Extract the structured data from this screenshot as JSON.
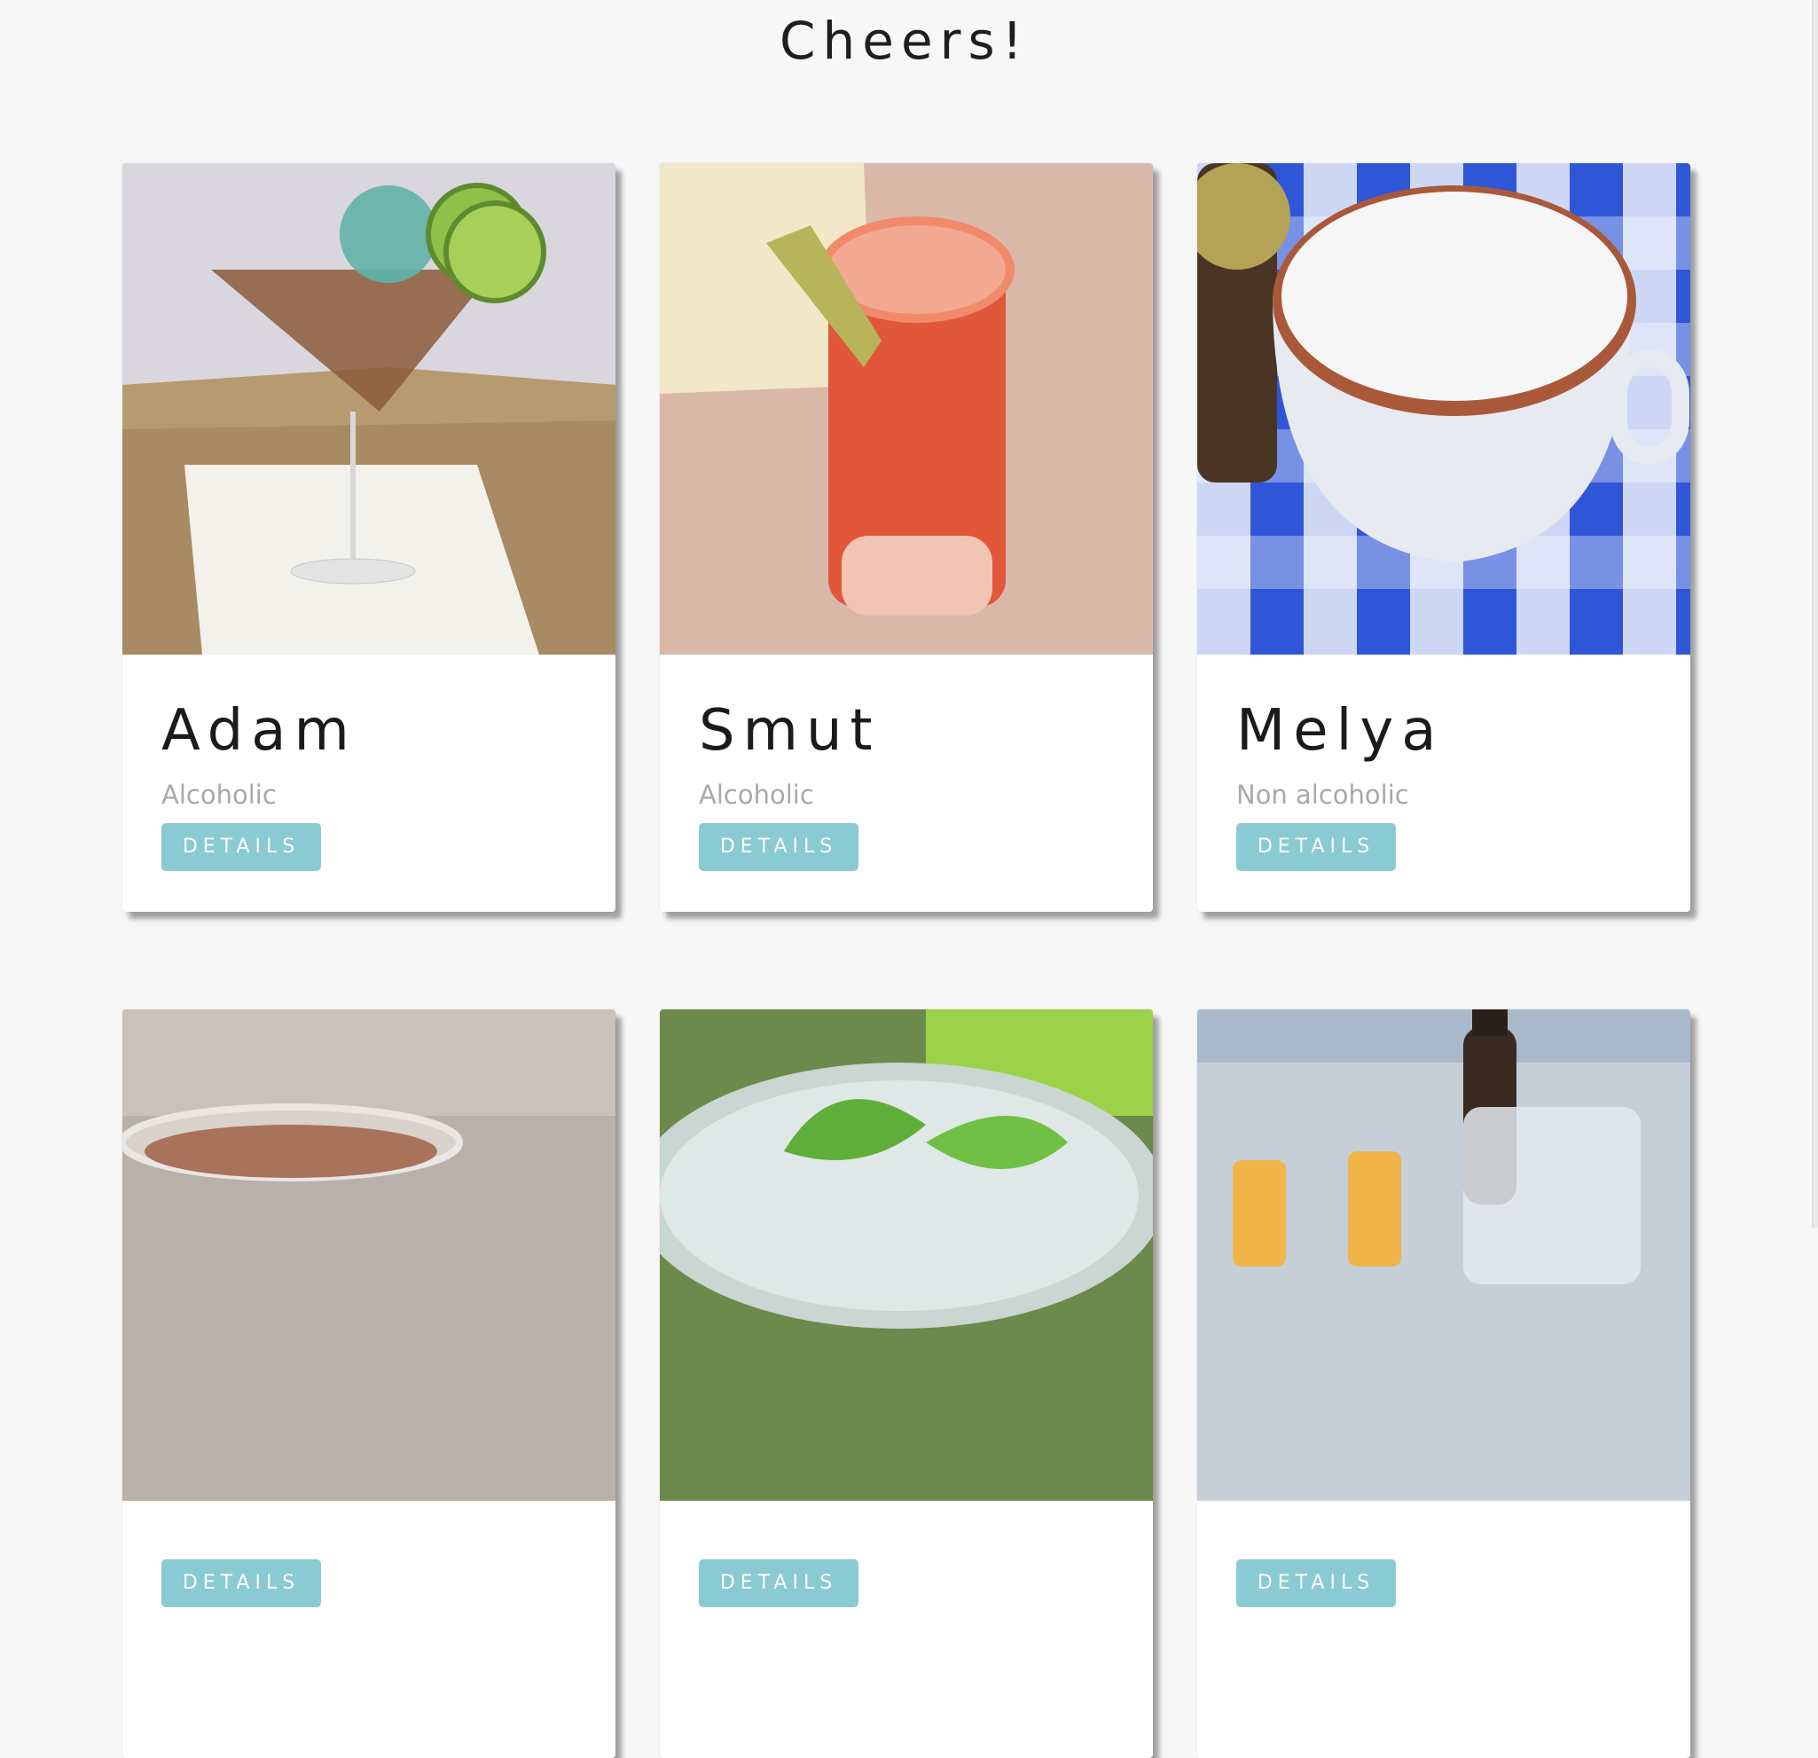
{
  "header": {
    "title": "Cheers!"
  },
  "drinks": [
    {
      "name": "Adam",
      "type": "Alcoholic",
      "details_label": "DETAILS"
    },
    {
      "name": "Smut",
      "type": "Alcoholic",
      "details_label": "DETAILS"
    },
    {
      "name": "Melya",
      "type": "Non alcoholic",
      "details_label": "DETAILS"
    },
    {
      "name": "",
      "type": "",
      "details_label": "DETAILS"
    },
    {
      "name": "",
      "type": "",
      "details_label": "DETAILS"
    },
    {
      "name": "",
      "type": "",
      "details_label": "DETAILS"
    }
  ],
  "colors": {
    "background": "#f7f7f7",
    "button": "#8acad2",
    "title_text": "#1e1e1e",
    "subtitle_text": "#a9a9a9"
  }
}
